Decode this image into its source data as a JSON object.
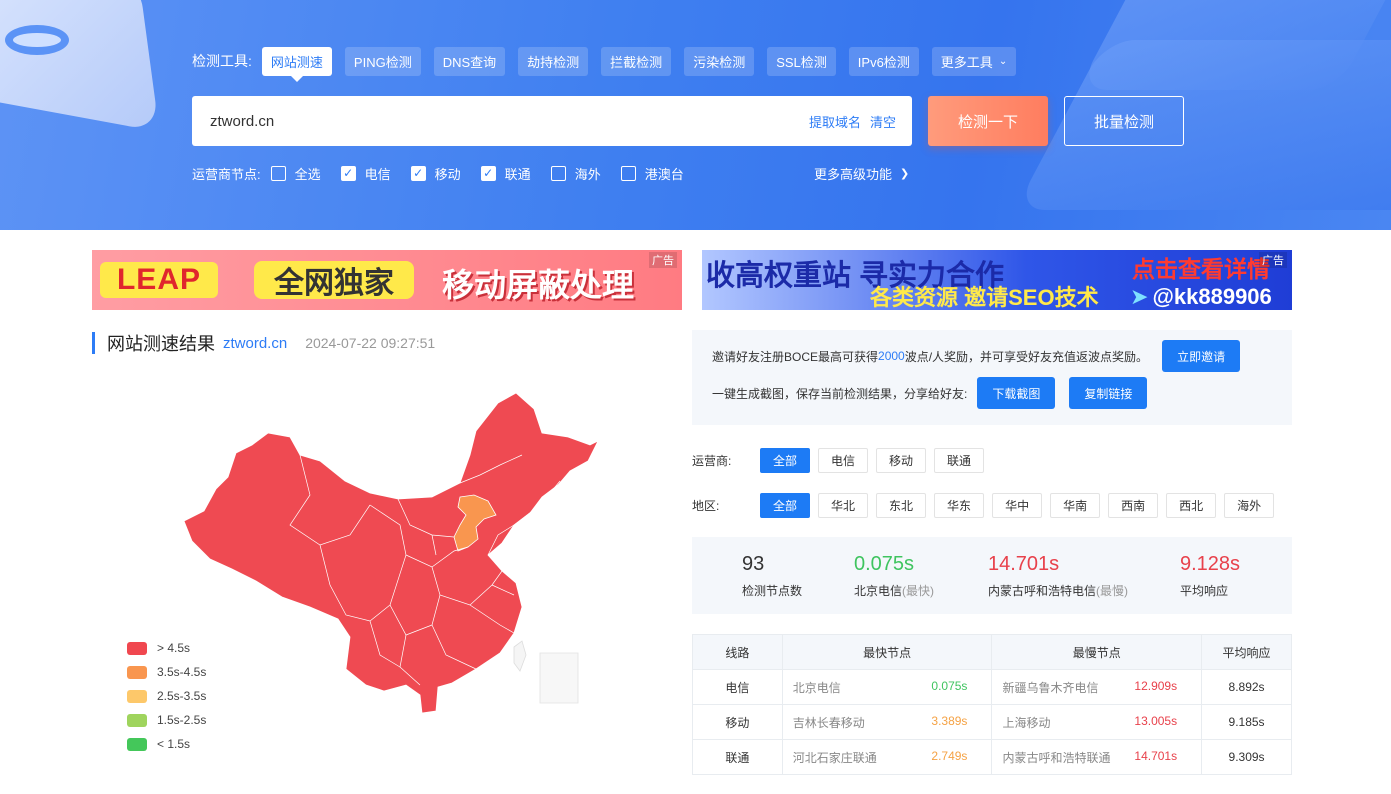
{
  "header": {
    "tools_label": "检测工具:",
    "tools": [
      {
        "label": "网站测速",
        "active": true
      },
      {
        "label": "PING检测"
      },
      {
        "label": "DNS查询"
      },
      {
        "label": "劫持检测"
      },
      {
        "label": "拦截检测"
      },
      {
        "label": "污染检测"
      },
      {
        "label": "SSL检测"
      },
      {
        "label": "IPv6检测"
      }
    ],
    "more_tools": "更多工具",
    "search_value": "ztword.cn",
    "extract_domain": "提取域名",
    "clear": "清空",
    "detect_button": "检测一下",
    "batch_button": "批量检测",
    "isp_label": "运营商节点:",
    "isp_options": [
      {
        "label": "全选",
        "checked": false
      },
      {
        "label": "电信",
        "checked": true
      },
      {
        "label": "移动",
        "checked": true
      },
      {
        "label": "联通",
        "checked": true
      },
      {
        "label": "海外",
        "checked": false
      },
      {
        "label": "港澳台",
        "checked": false
      }
    ],
    "more_advanced": "更多高级功能"
  },
  "ads": {
    "tag": "广告",
    "ad1": {
      "leap": "LEAP",
      "t2": "全网独家",
      "t3": "移动屏蔽处理"
    },
    "ad2": {
      "a1": "收高权重站 寻实力合作",
      "a2": "各类资源 邀请SEO技术",
      "a3": "点击查看详情",
      "a4": "@kk889906"
    }
  },
  "result": {
    "title": "网站测速结果",
    "domain": "ztword.cn",
    "time": "2024-07-22 09:27:51"
  },
  "legend": [
    {
      "label": "> 4.5s",
      "color": "#f0474f"
    },
    {
      "label": "3.5s-4.5s",
      "color": "#f9964f"
    },
    {
      "label": "2.5s-3.5s",
      "color": "#fdc86a"
    },
    {
      "label": "1.5s-2.5s",
      "color": "#9fd45d"
    },
    {
      "label": "< 1.5s",
      "color": "#44c75a"
    }
  ],
  "invite": {
    "line1_pre": "邀请好友注册BOCE最高可获得",
    "line1_num": "2000",
    "line1_post": "波点/人奖励，并可享受好友充值返波点奖励。",
    "invite_button": "立即邀请",
    "line2": "一键生成截图，保存当前检测结果，分享给好友:",
    "download_button": "下载截图",
    "copy_button": "复制链接"
  },
  "filters": {
    "isp_label": "运营商:",
    "isp": [
      "全部",
      "电信",
      "移动",
      "联通"
    ],
    "region_label": "地区:",
    "region": [
      "全部",
      "华北",
      "东北",
      "华东",
      "华中",
      "华南",
      "西南",
      "西北",
      "海外"
    ]
  },
  "stats": {
    "count": {
      "value": "93",
      "label": "检测节点数"
    },
    "fastest": {
      "value": "0.075s",
      "label": "北京电信",
      "sub": "(最快)"
    },
    "slowest": {
      "value": "14.701s",
      "label": "内蒙古呼和浩特电信",
      "sub": "(最慢)"
    },
    "average": {
      "value": "9.128s",
      "label": "平均响应"
    }
  },
  "table": {
    "headers": [
      "线路",
      "最快节点",
      "最慢节点",
      "平均响应"
    ],
    "rows": [
      {
        "line": "电信",
        "fast_node": "北京电信",
        "fast_time": "0.075s",
        "slow_node": "新疆乌鲁木齐电信",
        "slow_time": "12.909s",
        "avg": "8.892s"
      },
      {
        "line": "移动",
        "fast_node": "吉林长春移动",
        "fast_time": "3.389s",
        "slow_node": "上海移动",
        "slow_time": "13.005s",
        "avg": "9.185s"
      },
      {
        "line": "联通",
        "fast_node": "河北石家庄联通",
        "fast_time": "2.749s",
        "slow_node": "内蒙古呼和浩特联通",
        "slow_time": "14.701s",
        "avg": "9.309s"
      }
    ]
  },
  "colors": {
    "primary": "#1d7bf5",
    "map_red": "#ef4a52",
    "map_orange": "#f9964f"
  }
}
